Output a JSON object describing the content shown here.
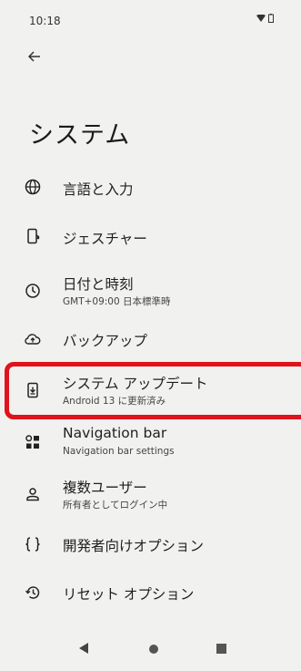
{
  "status_bar": {
    "time": "10:18"
  },
  "page": {
    "title": "システム"
  },
  "items": [
    {
      "icon": "globe-icon",
      "title": "言語と入力",
      "subtitle": ""
    },
    {
      "icon": "gesture-phone-icon",
      "title": "ジェスチャー",
      "subtitle": ""
    },
    {
      "icon": "clock-icon",
      "title": "日付と時刻",
      "subtitle": "GMT+09:00 日本標準時"
    },
    {
      "icon": "cloud-upload-icon",
      "title": "バックアップ",
      "subtitle": ""
    },
    {
      "icon": "system-update-icon",
      "title": "システム アップデート",
      "subtitle": "Android 13 に更新済み"
    },
    {
      "icon": "navigation-bar-icon",
      "title": "Navigation bar",
      "subtitle": "Navigation bar settings"
    },
    {
      "icon": "person-icon",
      "title": "複数ユーザー",
      "subtitle": "所有者としてログイン中"
    },
    {
      "icon": "braces-icon",
      "title": "開発者向けオプション",
      "subtitle": ""
    },
    {
      "icon": "restore-icon",
      "title": "リセット オプション",
      "subtitle": ""
    }
  ],
  "colors": {
    "background": "#f1f1ef",
    "highlight": "#e0121b",
    "text": "#1f1f1f"
  }
}
